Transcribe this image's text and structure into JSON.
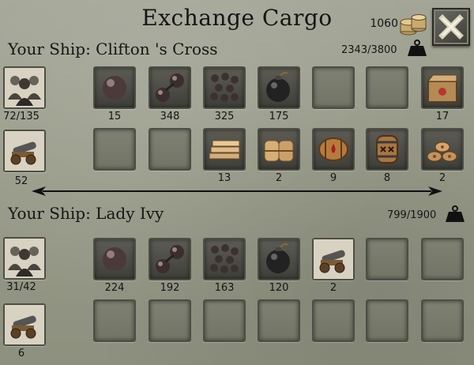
{
  "title": "Exchange Cargo",
  "money": "1060",
  "ship1": {
    "name": "Your Ship: Clifton 's Cross",
    "weight": "2343/3800",
    "crew": "72/135",
    "cannons": "52",
    "row1": [
      {
        "item": "cannonball",
        "qty": "15"
      },
      {
        "item": "chain-shot",
        "qty": "348"
      },
      {
        "item": "grapeshot",
        "qty": "325"
      },
      {
        "item": "bomb",
        "qty": "175"
      },
      {
        "item": "empty",
        "qty": ""
      },
      {
        "item": "empty",
        "qty": ""
      },
      {
        "item": "cargo-crate",
        "qty": "17"
      }
    ],
    "row2": [
      {
        "item": "empty",
        "qty": ""
      },
      {
        "item": "empty",
        "qty": ""
      },
      {
        "item": "planks",
        "qty": "13"
      },
      {
        "item": "sacks",
        "qty": "2"
      },
      {
        "item": "wine-barrel",
        "qty": "9"
      },
      {
        "item": "rum-barrel",
        "qty": "8"
      },
      {
        "item": "firewood",
        "qty": "2"
      }
    ]
  },
  "ship2": {
    "name": "Your Ship: Lady Ivy",
    "weight": "799/1900",
    "crew": "31/42",
    "cannons": "6",
    "row1": [
      {
        "item": "cannonball",
        "qty": "224"
      },
      {
        "item": "chain-shot",
        "qty": "192"
      },
      {
        "item": "grapeshot",
        "qty": "163"
      },
      {
        "item": "bomb",
        "qty": "120"
      },
      {
        "item": "cannon",
        "qty": "2"
      },
      {
        "item": "empty",
        "qty": ""
      },
      {
        "item": "empty",
        "qty": ""
      }
    ],
    "row2": [
      {
        "item": "empty",
        "qty": ""
      },
      {
        "item": "empty",
        "qty": ""
      },
      {
        "item": "empty",
        "qty": ""
      },
      {
        "item": "empty",
        "qty": ""
      },
      {
        "item": "empty",
        "qty": ""
      },
      {
        "item": "empty",
        "qty": ""
      },
      {
        "item": "empty",
        "qty": ""
      }
    ]
  },
  "colors": {
    "panel": "#979988",
    "slot_border": "#4d4e44",
    "text": "#151515"
  }
}
